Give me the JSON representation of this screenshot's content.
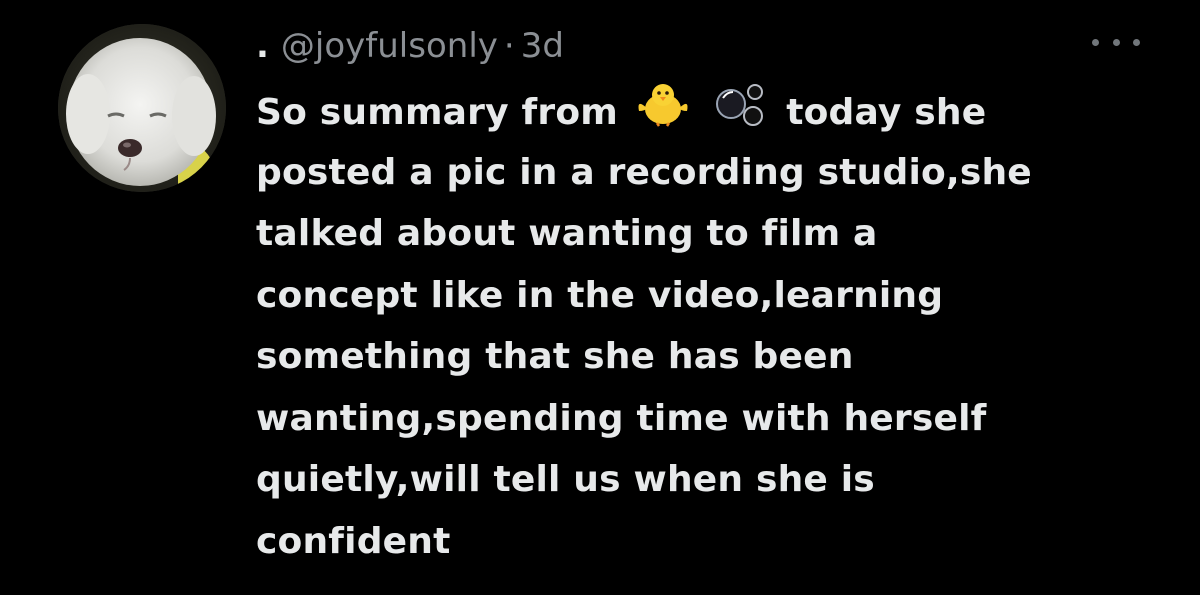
{
  "tweet": {
    "prefix": ".",
    "handle": "@joyfulsonly",
    "separator": "·",
    "time": "3d",
    "more_icon": "more-horizontal-icon",
    "lines": [
      {
        "before": "So summary from",
        "after": "today she"
      },
      "posted a pic in a recording studio,she",
      "talked about wanting to film a",
      "concept like in the video,learning",
      "something that she has been",
      "wanting,spending time with herself",
      "quietly,will tell us when she is",
      "confident"
    ],
    "emojis": [
      "chick-emoji",
      "bubbles-emoji"
    ]
  },
  "colors": {
    "background": "#000000",
    "text_primary": "#e7e9ea",
    "text_secondary": "#8b8f94"
  }
}
